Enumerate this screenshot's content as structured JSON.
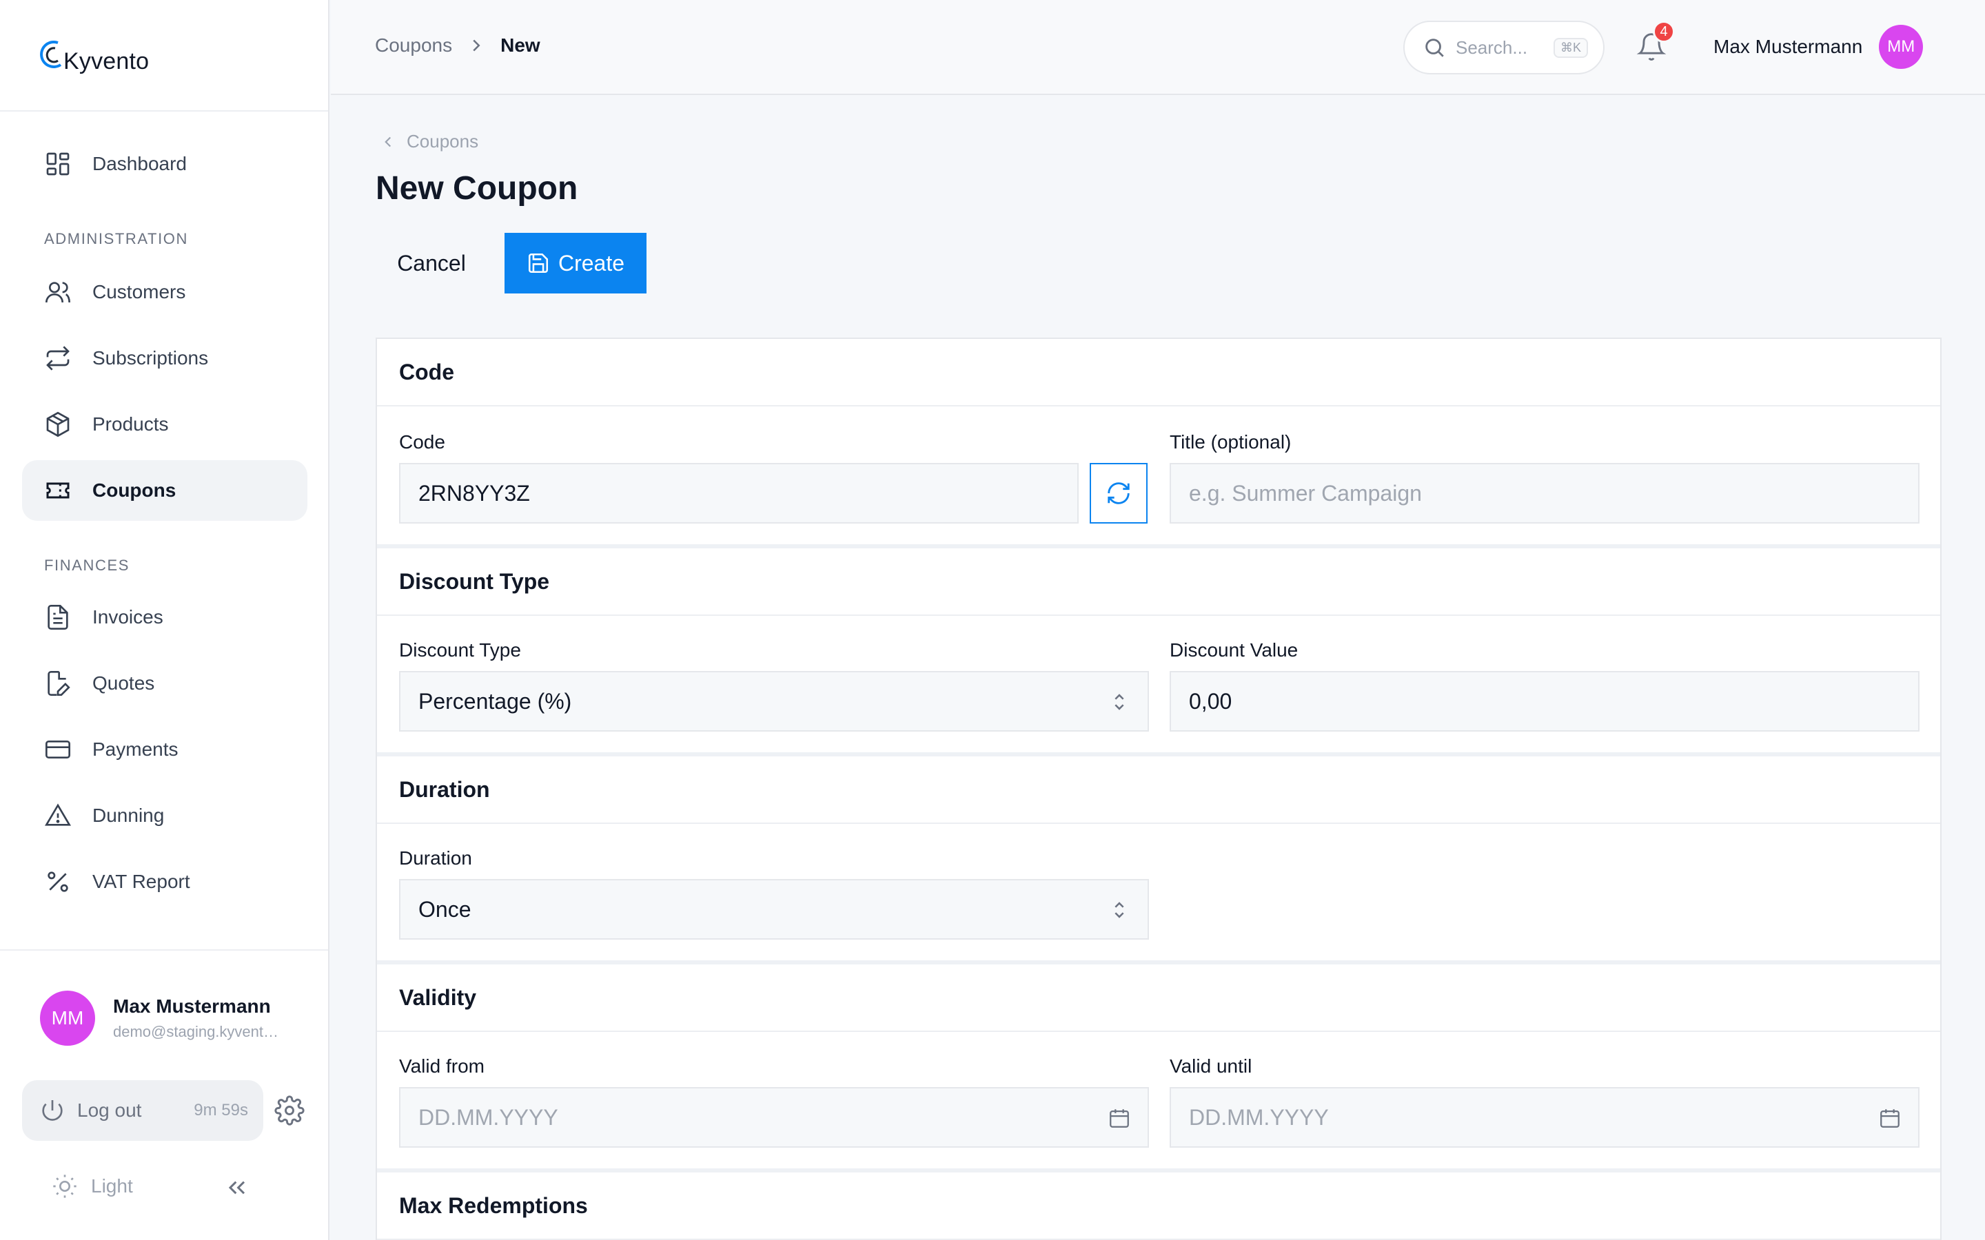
{
  "app": {
    "name": "Kyvento"
  },
  "sidebar": {
    "dashboard": "Dashboard",
    "sections": {
      "administration": "ADMINISTRATION",
      "finances": "FINANCES"
    },
    "admin_items": [
      {
        "label": "Customers",
        "icon": "users-icon"
      },
      {
        "label": "Subscriptions",
        "icon": "repeat-icon"
      },
      {
        "label": "Products",
        "icon": "box-icon"
      },
      {
        "label": "Coupons",
        "icon": "ticket-icon",
        "active": true
      }
    ],
    "finance_items": [
      {
        "label": "Invoices",
        "icon": "file-icon"
      },
      {
        "label": "Quotes",
        "icon": "file-edit-icon"
      },
      {
        "label": "Payments",
        "icon": "credit-card-icon"
      },
      {
        "label": "Dunning",
        "icon": "warning-icon"
      },
      {
        "label": "VAT Report",
        "icon": "percent-icon"
      }
    ],
    "user": {
      "initials": "MM",
      "name": "Max Mustermann",
      "email": "demo@staging.kyvento.com"
    },
    "logout": {
      "label": "Log out",
      "timer": "9m 59s"
    },
    "theme": {
      "label": "Light"
    }
  },
  "topbar": {
    "breadcrumb": {
      "parent": "Coupons",
      "current": "New"
    },
    "search": {
      "placeholder": "Search...",
      "shortcut": "⌘K"
    },
    "notifications": {
      "count": "4"
    },
    "user": {
      "name": "Max Mustermann",
      "initials": "MM"
    }
  },
  "page": {
    "back_label": "Coupons",
    "title": "New Coupon",
    "cancel_label": "Cancel",
    "create_label": "Create"
  },
  "form": {
    "code_section": {
      "title": "Code",
      "code_label": "Code",
      "code_value": "2RN8YY3Z",
      "title_label": "Title (optional)",
      "title_placeholder": "e.g. Summer Campaign"
    },
    "discount_section": {
      "title": "Discount Type",
      "type_label": "Discount Type",
      "type_value": "Percentage (%)",
      "value_label": "Discount Value",
      "value_value": "0,00"
    },
    "duration_section": {
      "title": "Duration",
      "duration_label": "Duration",
      "duration_value": "Once"
    },
    "validity_section": {
      "title": "Validity",
      "from_label": "Valid from",
      "from_placeholder": "DD.MM.YYYY",
      "until_label": "Valid until",
      "until_placeholder": "DD.MM.YYYY"
    },
    "redemptions_section": {
      "title": "Max Redemptions"
    }
  },
  "colors": {
    "accent": "#0b84f0",
    "avatar": "#d946ef",
    "badge": "#ef4444"
  }
}
